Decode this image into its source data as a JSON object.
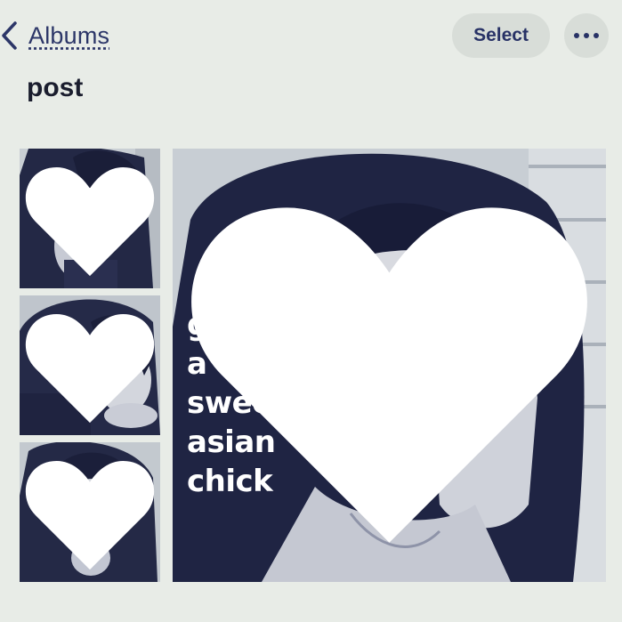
{
  "header": {
    "back_label": "Albums",
    "back_icon": "chevron-left-icon",
    "select_label": "Select",
    "more_icon": "ellipsis-icon"
  },
  "album": {
    "title": "post"
  },
  "photos": [
    {
      "favorite": true
    },
    {
      "favorite": true
    },
    {
      "favorite": true
    },
    {
      "favorite": true,
      "caption_lines": [
        "got",
        "a",
        "sweet",
        "asian",
        "chick"
      ]
    }
  ],
  "colors": {
    "accent": "#2c3668",
    "background": "#e8ece7",
    "button_bg": "#d8ddd8",
    "photo_tint": "#2a2f56"
  }
}
